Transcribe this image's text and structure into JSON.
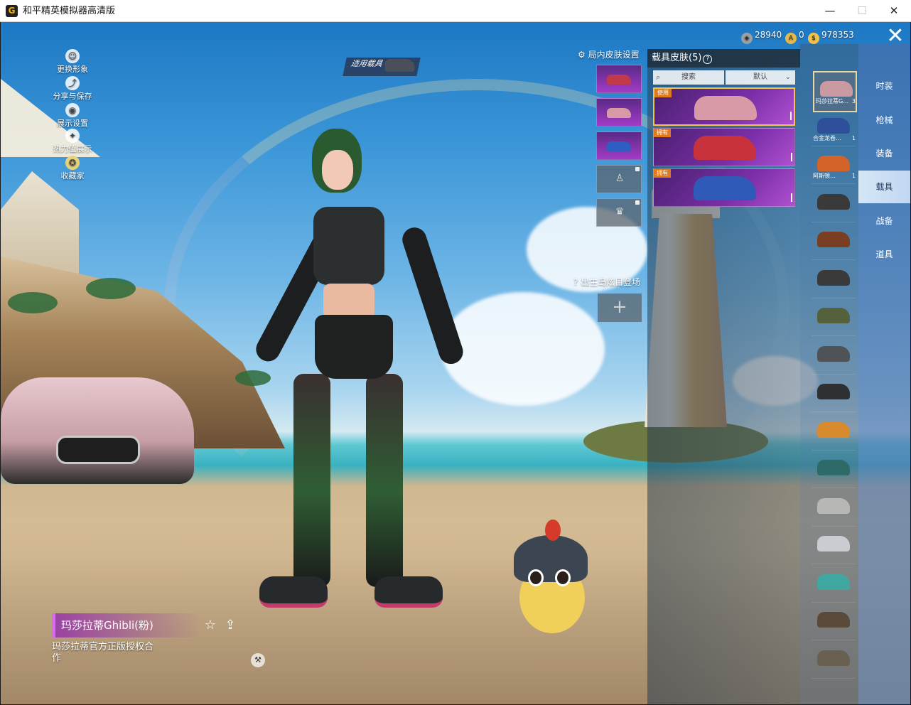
{
  "window": {
    "title": "和平精英模拟器高清版",
    "app_icon_glyph": "G",
    "minimize_glyph": "—",
    "maximize_glyph": "☐",
    "close_glyph": "✕"
  },
  "side_menu": [
    {
      "label": "更换形象",
      "icon": "person-icon",
      "glyph": "☺"
    },
    {
      "label": "分享与保存",
      "icon": "share-save-icon",
      "glyph": "⤴"
    },
    {
      "label": "展示设置",
      "icon": "eye-icon",
      "glyph": "◉"
    },
    {
      "label": "热力值展示",
      "icon": "fire-icon",
      "glyph": "✦"
    },
    {
      "label": "收藏家",
      "icon": "collector-badge-icon",
      "glyph": "✪"
    }
  ],
  "vehicle_label": "适用载具",
  "item": {
    "name": "玛莎拉蒂Ghibli(粉)",
    "description": "玛莎拉蒂官方正版授权合作",
    "fav_glyph": "☆",
    "share_glyph": "⇪"
  },
  "ingame": {
    "title": "局内皮肤设置",
    "slots": [
      {
        "type": "car",
        "color": "#c23a4a",
        "icon": "red-car-icon"
      },
      {
        "type": "car",
        "color": "#d79aa6",
        "icon": "pink-car-icon"
      },
      {
        "type": "car",
        "color": "#2e5ec2",
        "icon": "blue-car-icon"
      },
      {
        "type": "locked",
        "glyph": "♙",
        "icon": "character-lock-icon"
      },
      {
        "type": "locked",
        "glyph": "♛",
        "icon": "crown-lock-icon"
      }
    ],
    "spawn_title": "出生岛炫目登场",
    "spawn_add_glyph": "+"
  },
  "skin_panel": {
    "title": "载具皮肤",
    "count": "(5)",
    "help_glyph": "?",
    "search_placeholder": "搜索",
    "search_glyph": "⌕",
    "sort_value": "默认",
    "sort_chevron": "⌄",
    "cards": [
      {
        "badge": "使用",
        "color": "#d79aa6",
        "selected": true
      },
      {
        "badge": "拥有",
        "color": "#c8323c",
        "selected": false
      },
      {
        "badge": "拥有",
        "color": "#2f5ab8",
        "selected": false
      }
    ]
  },
  "vehicle_list": [
    {
      "label": "玛莎拉蒂G…",
      "count": "3",
      "color": "#c99aa2",
      "selected": true
    },
    {
      "label": "合金龙卷…",
      "count": "1",
      "color": "#2e4f9a",
      "selected": false
    },
    {
      "label": "阿斯顿…",
      "count": "1",
      "color": "#d2642a",
      "selected": false
    },
    {
      "label": "",
      "count": "",
      "color": "#3a3a3a",
      "selected": false
    },
    {
      "label": "",
      "count": "",
      "color": "#7a3e22",
      "selected": false
    },
    {
      "label": "",
      "count": "",
      "color": "#3a3a3a",
      "selected": false
    },
    {
      "label": "",
      "count": "",
      "color": "#55603c",
      "selected": false
    },
    {
      "label": "",
      "count": "",
      "color": "#4f5358",
      "selected": false
    },
    {
      "label": "",
      "count": "",
      "color": "#2e3033",
      "selected": false
    },
    {
      "label": "",
      "count": "",
      "color": "#d88a2e",
      "selected": false
    },
    {
      "label": "",
      "count": "",
      "color": "#2d6a68",
      "selected": false
    },
    {
      "label": "",
      "count": "",
      "color": "#b7b7b4",
      "selected": false
    },
    {
      "label": "",
      "count": "",
      "color": "#c9ccd1",
      "selected": false
    },
    {
      "label": "",
      "count": "",
      "color": "#3fa7a0",
      "selected": false
    },
    {
      "label": "",
      "count": "",
      "color": "#5a4a3a",
      "selected": false
    },
    {
      "label": "",
      "count": "",
      "color": "#6a6052",
      "selected": false
    }
  ],
  "categories": [
    {
      "label": "时装",
      "active": false
    },
    {
      "label": "枪械",
      "active": false
    },
    {
      "label": "装备",
      "active": false
    },
    {
      "label": "载具",
      "active": true
    },
    {
      "label": "战备",
      "active": false
    },
    {
      "label": "道具",
      "active": false
    }
  ],
  "currency": [
    {
      "value": "28940",
      "icon": "coupon-icon",
      "color": "#9aa0a6",
      "glyph": "◈"
    },
    {
      "value": "0",
      "icon": "a-coin-icon",
      "color": "#e6b94a",
      "glyph": "A"
    },
    {
      "value": "978353",
      "icon": "gold-coin-icon",
      "color": "#f2c24a",
      "glyph": "$"
    }
  ],
  "close_game_glyph": "✕"
}
